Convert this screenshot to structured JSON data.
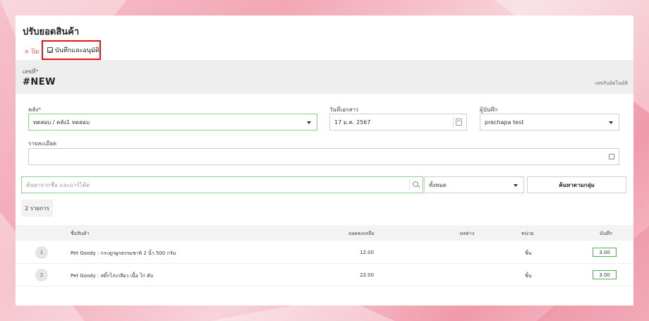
{
  "page": {
    "title": "ปรับยอดสินค้า"
  },
  "toolbar": {
    "close_label": "× ปิด",
    "save_approve_label": "บันทึกและอนุมัติ"
  },
  "document": {
    "number_label": "เลขที่",
    "number_value": "#NEW",
    "auto_hint": "เลขรันอัตโนมัติ"
  },
  "form": {
    "warehouse_label": "คลัง",
    "warehouse_value": "ทดสอบ / คลัง1 ทดสอบ",
    "doc_date_label": "วันที่เอกสาร",
    "doc_date_value": "17 ม.ค. 2567",
    "recorder_label": "ผู้บันทึก",
    "recorder_value": "prechapa test",
    "detail_label": "รายละเอียด",
    "detail_value": ""
  },
  "search": {
    "placeholder": "ค้นหาจากชื่อ และบาร์โค้ด",
    "filter_value": "ทั้งหมด",
    "group_button_label": "ค้นหาตามกลุ่ม"
  },
  "list": {
    "count_label": "2 รายการ",
    "columns": {
      "name": "ชื่อสินค้า",
      "balance": "ยอดคงเหลือ",
      "diff": "ผลต่าง",
      "unit": "หน่วย",
      "record": "บันทึก"
    },
    "rows": [
      {
        "index": "1",
        "name": "Pet Goody : กระดูกผูกธรรมชาติ 2 นิ้ว 500 กรัม",
        "balance": "12.00",
        "diff": "",
        "unit": "ชิ้น",
        "record": "3.00"
      },
      {
        "index": "2",
        "name": "Pet Goody : สติ๊กไก่เกลียว เนื้อ ไก่ ตับ",
        "balance": "22.00",
        "diff": "",
        "unit": "ชิ้น",
        "record": "3.00"
      }
    ]
  },
  "colors": {
    "accent_red": "#e81414",
    "input_green": "#4caf50"
  }
}
